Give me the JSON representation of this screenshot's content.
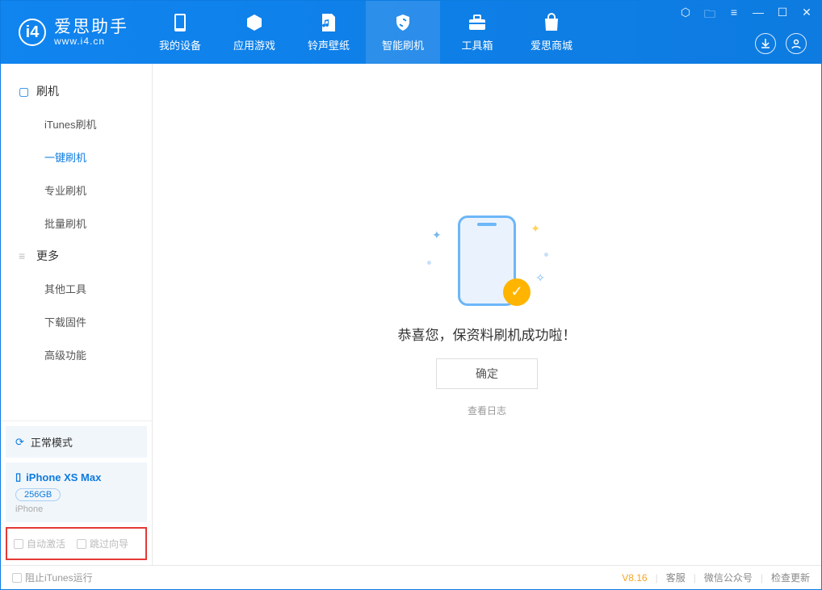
{
  "app": {
    "name": "爱思助手",
    "site": "www.i4.cn"
  },
  "nav": {
    "items": [
      {
        "label": "我的设备"
      },
      {
        "label": "应用游戏"
      },
      {
        "label": "铃声壁纸"
      },
      {
        "label": "智能刷机"
      },
      {
        "label": "工具箱"
      },
      {
        "label": "爱思商城"
      }
    ]
  },
  "sidebar": {
    "section1": {
      "title": "刷机"
    },
    "items1": [
      {
        "label": "iTunes刷机"
      },
      {
        "label": "一键刷机"
      },
      {
        "label": "专业刷机"
      },
      {
        "label": "批量刷机"
      }
    ],
    "section2": {
      "title": "更多"
    },
    "items2": [
      {
        "label": "其他工具"
      },
      {
        "label": "下载固件"
      },
      {
        "label": "高级功能"
      }
    ]
  },
  "device": {
    "mode": "正常模式",
    "name": "iPhone XS Max",
    "capacity": "256GB",
    "type": "iPhone"
  },
  "options": {
    "auto_activate": "自动激活",
    "skip_guide": "跳过向导"
  },
  "main": {
    "success": "恭喜您，保资料刷机成功啦！",
    "ok": "确定",
    "view_log": "查看日志"
  },
  "footer": {
    "block_itunes": "阻止iTunes运行",
    "version": "V8.16",
    "support": "客服",
    "wechat": "微信公众号",
    "update": "检查更新"
  }
}
